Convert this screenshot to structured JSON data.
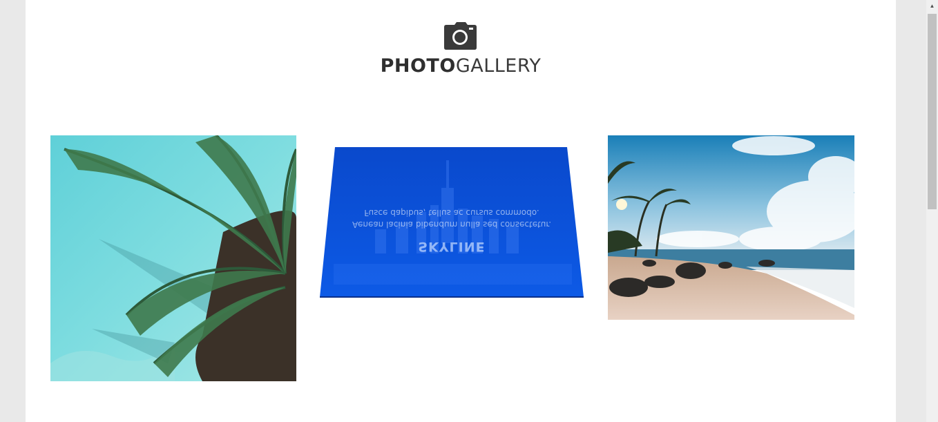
{
  "brand": {
    "title_bold": "PHOTO",
    "title_light": "GALLERY",
    "icon": "camera-icon"
  },
  "gallery": {
    "items": [
      {
        "name": "palm-tree-pool",
        "kind": "photo"
      },
      {
        "name": "skyline",
        "kind": "flipped-card",
        "title": "SKYLINE",
        "description_line1": "Aenean lacinia bibendum nulla sed consectetur.",
        "description_line2": "Fusce dapibus, tellus ac cursus commodo."
      },
      {
        "name": "tropical-beach",
        "kind": "photo"
      }
    ]
  },
  "colors": {
    "page_bg": "#e9e9e9",
    "content_bg": "#ffffff",
    "skyline_blue": "#0b4fd6",
    "text_dark": "#2f2f2f"
  }
}
